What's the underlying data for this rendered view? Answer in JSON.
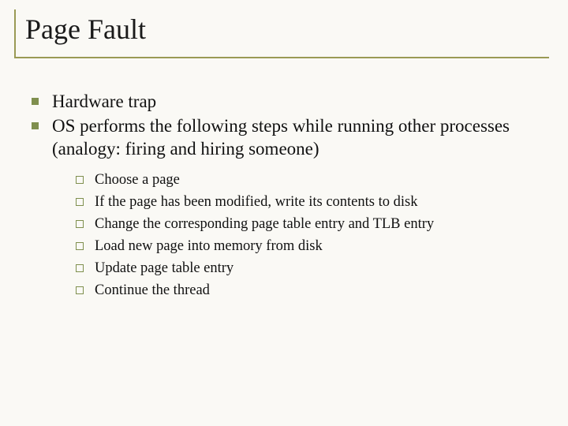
{
  "title": "Page Fault",
  "level1": [
    {
      "text": "Hardware trap"
    },
    {
      "text": "OS performs the following steps while running other processes (analogy:  firing and hiring someone)"
    }
  ],
  "level2": [
    {
      "text": "Choose a page"
    },
    {
      "text": "If the page has been modified, write its contents to disk"
    },
    {
      "text": "Change the corresponding page table entry and TLB entry"
    },
    {
      "text": "Load new page into memory from disk"
    },
    {
      "text": "Update page table entry"
    },
    {
      "text": "Continue the thread"
    }
  ]
}
